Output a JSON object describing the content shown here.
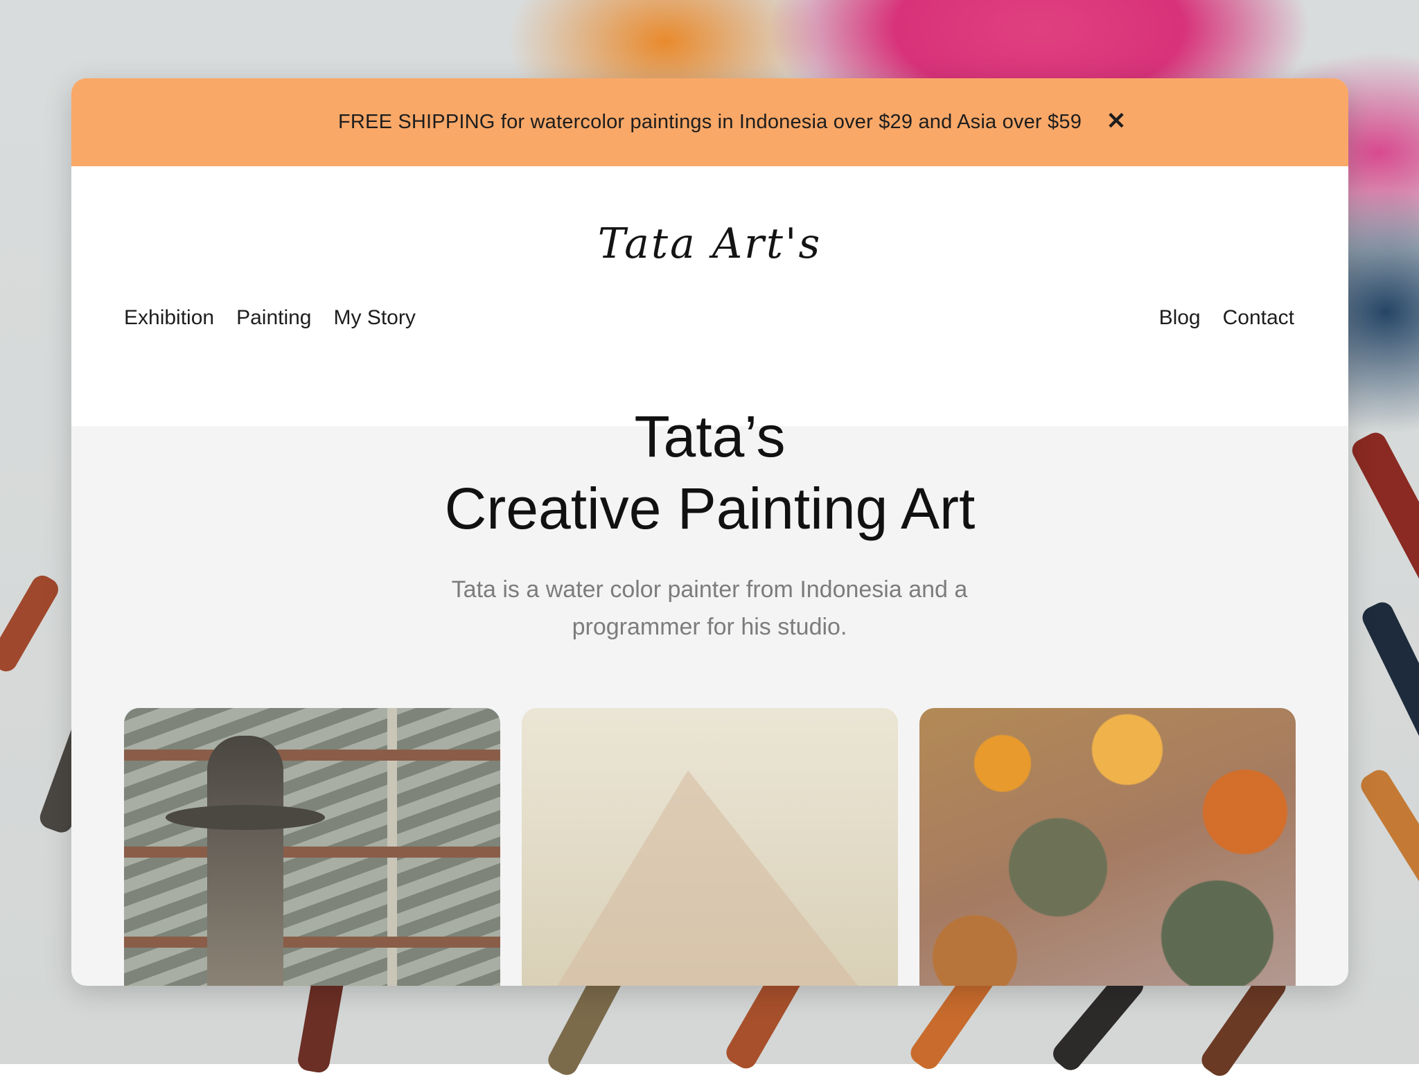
{
  "announcement": {
    "text": "FREE SHIPPING for watercolor paintings in Indonesia over $29 and Asia over $59",
    "close_icon": "close-icon",
    "close_glyph": "✕",
    "background": "#f9a868"
  },
  "header": {
    "logo": "Tata Art's",
    "nav_left": [
      "Exhibition",
      "Painting",
      "My Story"
    ],
    "nav_right": [
      "Blog",
      "Contact"
    ]
  },
  "hero": {
    "title_line1": "Tata’s",
    "title_line2": "Creative Painting Art",
    "subtitle": "Tata is a water color painter from Indonesia and a programmer for his studio."
  },
  "gallery": {
    "images": [
      "fountain-painting",
      "mountain-watercolor",
      "autumn-foliage-painting"
    ]
  }
}
